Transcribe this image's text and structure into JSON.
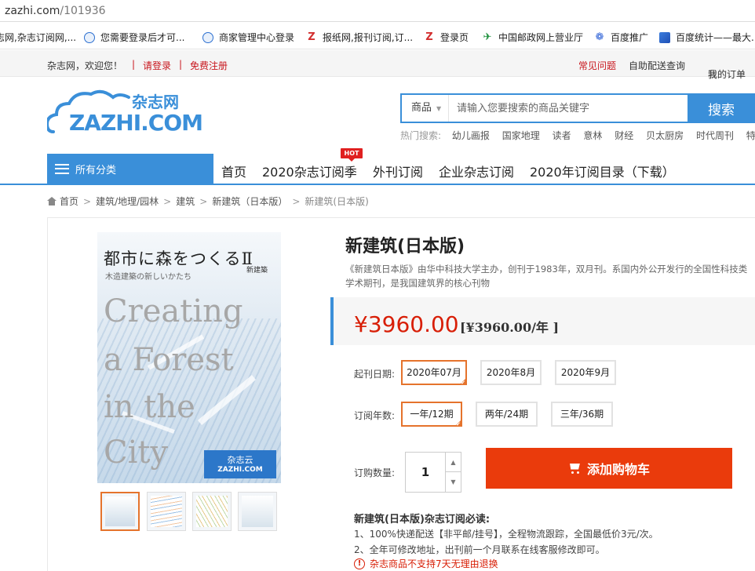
{
  "browser": {
    "url_domain": "zazhi.com",
    "url_path": "/101936"
  },
  "bookmarks": [
    {
      "label": "志网,杂志订阅网,...",
      "icon": "zazhi-icon"
    },
    {
      "label": "您需要登录后才可...",
      "icon": "zazhi-icon"
    },
    {
      "label": "商家管理中心登录",
      "icon": "zazhi-icon"
    },
    {
      "label": "报纸网,报刊订阅,订...",
      "icon": "z-red-icon"
    },
    {
      "label": "登录页",
      "icon": "z-red-icon"
    },
    {
      "label": "中国邮政网上营业厅",
      "icon": "post-icon"
    },
    {
      "label": "百度推广",
      "icon": "baidu-paw-icon"
    },
    {
      "label": "百度统计——最大...",
      "icon": "chart-icon"
    }
  ],
  "topnav": {
    "welcome": "杂志网，欢迎您！",
    "login": "请登录",
    "register": "免费注册",
    "faq": "常见问题",
    "self_service": "自助配送查询",
    "my_orders": "我的订单"
  },
  "header": {
    "logo_cn": "杂志网",
    "logo_en": "ZAZHI.COM",
    "search_category": "商品",
    "search_placeholder": "请输入您要搜索的商品关键字",
    "search_button": "搜索",
    "hot_label": "热门搜索:",
    "hot_keywords": [
      "幼儿画报",
      "国家地理",
      "读者",
      "意林",
      "财经",
      "贝太厨房",
      "时代周刊",
      "特别关注"
    ]
  },
  "mainnav": {
    "all_categories": "所有分类",
    "hot_badge": "HOT",
    "links": [
      "首页",
      "2020杂志订阅季",
      "外刊订阅",
      "企业杂志订阅",
      "2020年订阅目录（下载）"
    ]
  },
  "breadcrumb": [
    "首页",
    "建筑/地理/园林",
    "建筑",
    "新建筑（日本版）",
    "新建筑(日本版)"
  ],
  "cover": {
    "jp_title": "都市に森をつくるⅡ",
    "jp_subtitle": "木造建築の新しいかたち",
    "magazine": "新建築",
    "en_lines": [
      "Creating",
      "a Forest",
      "in the",
      "City"
    ],
    "badge_logo": "杂志云",
    "badge_en": "ZAZHI.COM"
  },
  "product": {
    "title": "新建筑(日本版)",
    "description": "《新建筑日本版》由华中科技大学主办，创刊于1983年，双月刊。系国内外公开发行的全国性科技类学术期刊，是我国建筑界的核心刊物",
    "price": "¥3960.00",
    "price_note": "[¥3960.00/年 ]",
    "start_label": "起刊日期:",
    "start_options": [
      "2020年07月",
      "2020年8月",
      "2020年9月"
    ],
    "start_selected": 0,
    "years_label": "订阅年数:",
    "year_options": [
      "一年/12期",
      "两年/24期",
      "三年/36期"
    ],
    "year_selected": 0,
    "qty_label": "订购数量:",
    "qty": "1",
    "cart_button": "添加购物车",
    "notice_title": "新建筑(日本版)杂志订阅必读:",
    "notices": [
      "1、100%快递配送【非平邮/挂号】，全程物流跟踪，全国最低价3元/次。",
      "2、全年可修改地址，出刊前一个月联系在线客服修改即可。"
    ],
    "warning": "杂志商品不支持7天无理由退换"
  },
  "colors": {
    "brand_blue": "#3a8fd9",
    "price_red": "#d81e06",
    "cart_orange": "#ea3b0c",
    "select_orange": "#e5732c"
  }
}
